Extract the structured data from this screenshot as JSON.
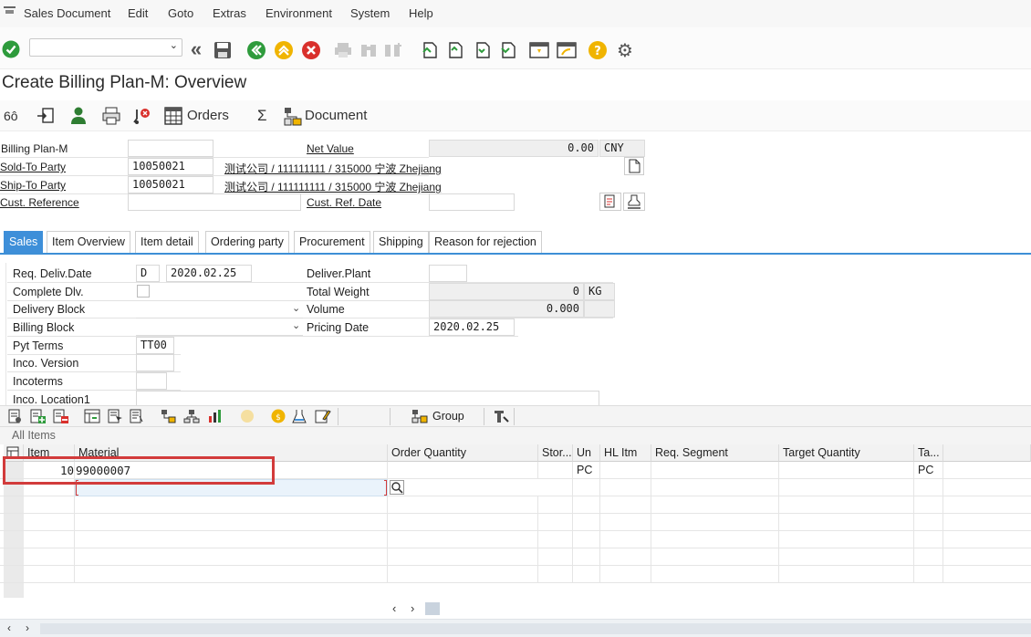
{
  "menu": [
    "Sales Document",
    "Edit",
    "Goto",
    "Extras",
    "Environment",
    "System",
    "Help"
  ],
  "title": "Create Billing Plan-M: Overview",
  "app_toolbar": {
    "orders_label": "Orders",
    "sigma": "Σ",
    "document_label": "Document"
  },
  "header": {
    "billing_plan_label": "Billing Plan-M",
    "billing_plan_value": "",
    "net_value_label": "Net Value",
    "net_value": "0.00",
    "currency": "CNY",
    "sold_to_label": "Sold-To Party",
    "sold_to_value": "10050021",
    "sold_to_desc": "测试公司 / 111111111 / 315000 宁波 Zhejiang",
    "ship_to_label": "Ship-To Party",
    "ship_to_value": "10050021",
    "ship_to_desc": "测试公司 / 111111111 / 315000 宁波 Zhejiang",
    "cust_ref_label": "Cust. Reference",
    "cust_ref_value": "",
    "cust_ref_date_label": "Cust. Ref. Date",
    "cust_ref_date_value": ""
  },
  "tabs": [
    "Sales",
    "Item Overview",
    "Item detail",
    "Ordering party",
    "Procurement",
    "Shipping",
    "Reason for rejection"
  ],
  "sales": {
    "req_deliv_label": "Req. Deliv.Date",
    "req_deliv_type": "D",
    "req_deliv_value": "2020.02.25",
    "complete_dlv_label": "Complete Dlv.",
    "delivery_block_label": "Delivery Block",
    "billing_block_label": "Billing Block",
    "pyt_terms_label": "Pyt Terms",
    "pyt_terms_value": "TT00",
    "inco_version_label": "Inco. Version",
    "incoterms_label": "Incoterms",
    "inco_location_label": "Inco. Location1",
    "deliver_plant_label": "Deliver.Plant",
    "total_weight_label": "Total Weight",
    "total_weight_value": "0",
    "weight_unit": "KG",
    "volume_label": "Volume",
    "volume_value": "0.000",
    "pricing_date_label": "Pricing Date",
    "pricing_date_value": "2020.02.25"
  },
  "item_toolbar": {
    "group_label": "Group"
  },
  "items": {
    "section_label": "All Items",
    "columns": [
      "Item",
      "Material",
      "Order Quantity",
      "Stor...",
      "Un",
      "HL Itm",
      "Req. Segment",
      "Target Quantity",
      "Ta..."
    ],
    "rows": [
      {
        "item": "10",
        "material": "99000007",
        "un": "PC",
        "target_unit": "PC"
      }
    ]
  },
  "colors": {
    "accent": "#3e8fd9",
    "highlight": "#d23b3b",
    "green": "#2e9b3c",
    "red": "#d9302c",
    "yellow": "#f0b400"
  }
}
